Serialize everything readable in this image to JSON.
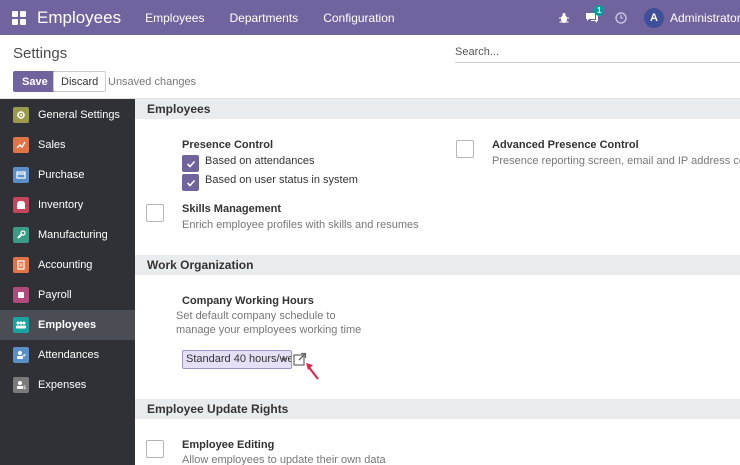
{
  "navbar": {
    "app_title": "Employees",
    "menu": [
      "Employees",
      "Departments",
      "Configuration"
    ],
    "chat_badge": "1",
    "avatar_letter": "A",
    "user_name": "Administrator (cb"
  },
  "control": {
    "breadcrumb": "Settings",
    "search_placeholder": "Search...",
    "save_label": "Save",
    "discard_label": "Discard",
    "unsaved_text": "Unsaved changes"
  },
  "sidebar": {
    "items": [
      {
        "label": "General Settings",
        "icon": "gear-icon",
        "color": "#9c9a4c"
      },
      {
        "label": "Sales",
        "icon": "chart-icon",
        "color": "#e07446"
      },
      {
        "label": "Purchase",
        "icon": "card-icon",
        "color": "#5a8fc7"
      },
      {
        "label": "Inventory",
        "icon": "box-icon",
        "color": "#c4465c"
      },
      {
        "label": "Manufacturing",
        "icon": "wrench-icon",
        "color": "#3a9c84"
      },
      {
        "label": "Accounting",
        "icon": "document-icon",
        "color": "#e07446"
      },
      {
        "label": "Payroll",
        "icon": "payroll-icon",
        "color": "#b04a7a"
      },
      {
        "label": "Employees",
        "icon": "people-icon",
        "color": "#1aa3a3"
      },
      {
        "label": "Attendances",
        "icon": "user-check-icon",
        "color": "#5a8fc7"
      },
      {
        "label": "Expenses",
        "icon": "expense-icon",
        "color": "#7a7a7a"
      }
    ],
    "active": "Employees"
  },
  "sections": {
    "employees": {
      "title": "Employees",
      "presence_control": {
        "title": "Presence Control",
        "option1": "Based on attendances",
        "option2": "Based on user status in system"
      },
      "advanced_presence": {
        "title": "Advanced Presence Control",
        "desc": "Presence reporting screen, email and IP address control."
      },
      "skills": {
        "title": "Skills Management",
        "desc": "Enrich employee profiles with skills and resumes"
      }
    },
    "work_org": {
      "title": "Work Organization",
      "working_hours": {
        "title": "Company Working Hours",
        "desc1": "Set default company schedule to",
        "desc2": "manage your employees working time",
        "value": "Standard 40 hours/we"
      }
    },
    "update_rights": {
      "title": "Employee Update Rights",
      "editing": {
        "title": "Employee Editing",
        "desc": "Allow employees to update their own data"
      }
    }
  },
  "colors": {
    "brand": "#71639e",
    "sidebar_bg": "#2f3136",
    "arrow": "#e0284f"
  }
}
